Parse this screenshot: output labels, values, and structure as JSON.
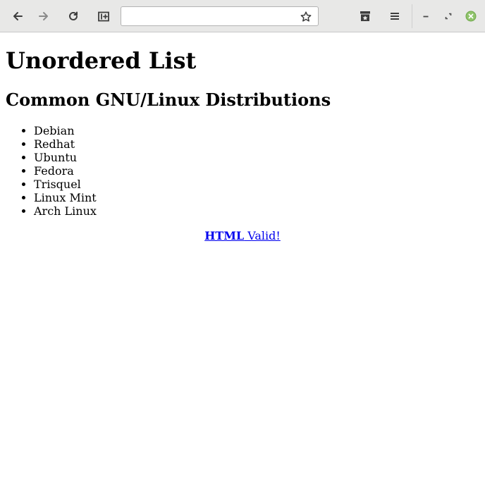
{
  "browser": {
    "url_value": "",
    "icons": {
      "back": "arrow-left-icon",
      "forward": "arrow-right-icon",
      "reload": "reload-icon",
      "new_tab": "new-tab-icon",
      "bookmark": "star-icon",
      "library": "library-icon",
      "menu": "hamburger-menu-icon",
      "minimize": "minimize-icon",
      "restore": "restore-icon",
      "close": "close-icon"
    },
    "colors": {
      "toolbar": "#e8e8e7",
      "close_button": "#8fc36b",
      "link": "#0000ee"
    }
  },
  "page": {
    "title": "Unordered List",
    "subtitle": "Common GNU/Linux Distributions",
    "distributions": [
      "Debian",
      "Redhat",
      "Ubuntu",
      "Fedora",
      "Trisquel",
      "Linux Mint",
      "Arch Linux"
    ],
    "validator": {
      "bold_text": "HTML",
      "text": " Valid!"
    }
  }
}
